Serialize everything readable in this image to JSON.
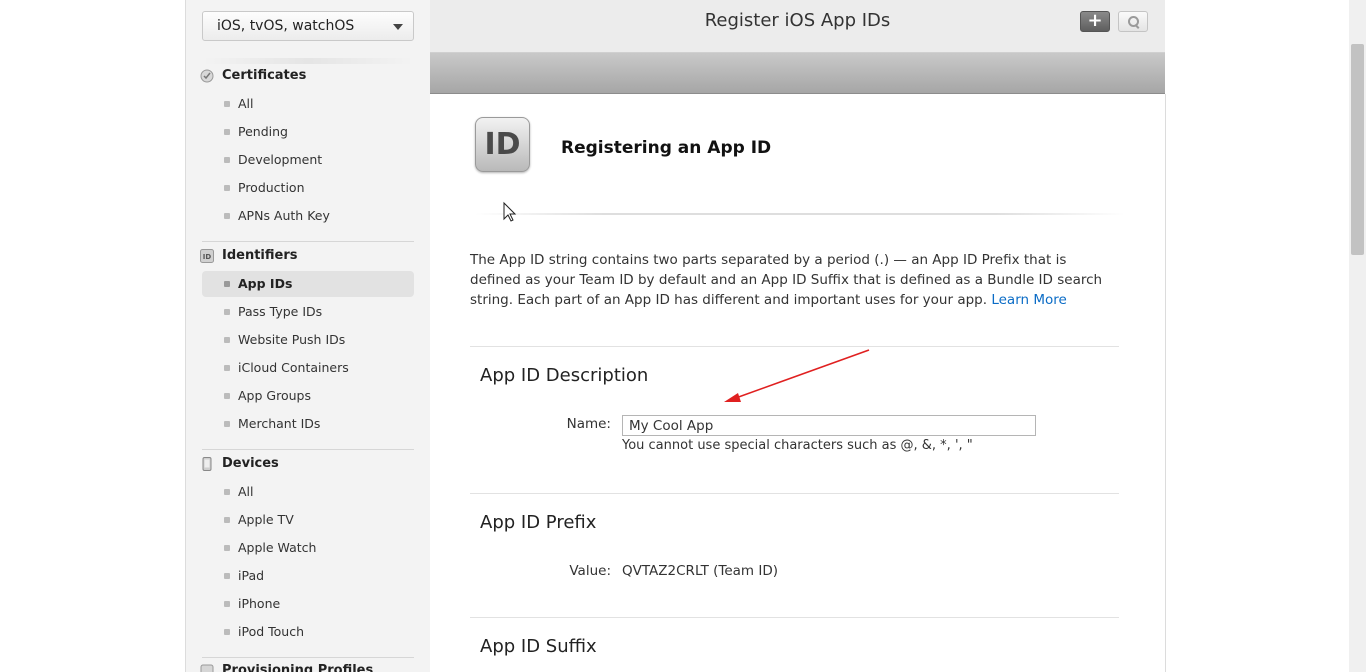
{
  "sidebar": {
    "platform_select": "iOS, tvOS, watchOS",
    "sections": {
      "certificates": {
        "title": "Certificates",
        "items": [
          "All",
          "Pending",
          "Development",
          "Production",
          "APNs Auth Key"
        ]
      },
      "identifiers": {
        "title": "Identifiers",
        "items": [
          "App IDs",
          "Pass Type IDs",
          "Website Push IDs",
          "iCloud Containers",
          "App Groups",
          "Merchant IDs"
        ],
        "active": "App IDs"
      },
      "devices": {
        "title": "Devices",
        "items": [
          "All",
          "Apple TV",
          "Apple Watch",
          "iPad",
          "iPhone",
          "iPod Touch"
        ]
      },
      "provisioning": {
        "title": "Provisioning Profiles"
      }
    }
  },
  "header": {
    "title": "Register iOS App IDs",
    "add_icon": "plus-icon",
    "search_icon": "search-icon"
  },
  "main": {
    "icon_text": "ID",
    "heading": "Registering an App ID",
    "intro": "The App ID string contains two parts separated by a period (.) — an App ID Prefix that is defined as your Team ID by default and an App ID Suffix that is defined as a Bundle ID search string. Each part of an App ID has different and important uses for your app.",
    "learn_more": "Learn More",
    "description": {
      "title": "App ID Description",
      "name_label": "Name:",
      "name_value": "My Cool App",
      "hint": "You cannot use special characters such as @, &, *, ', \""
    },
    "prefix": {
      "title": "App ID Prefix",
      "value_label": "Value:",
      "value": "QVTAZ2CRLT (Team ID)"
    },
    "suffix": {
      "title": "App ID Suffix"
    }
  },
  "colors": {
    "link": "#0b6cc6",
    "annotation_arrow": "#e02020"
  }
}
